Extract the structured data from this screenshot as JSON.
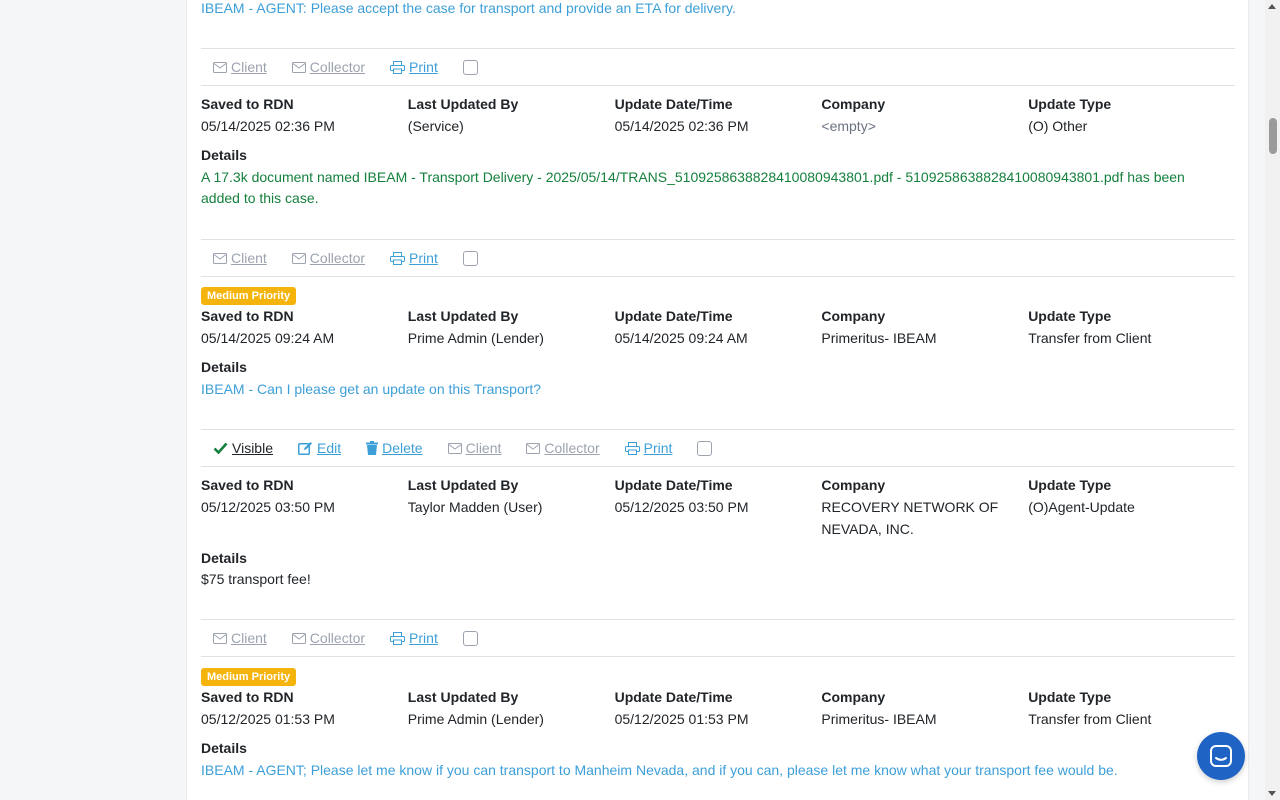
{
  "colors": {
    "link": "#3d9fd8",
    "badge": "#f5b40b",
    "system_text": "#15803d",
    "chat_button": "#1f64c4"
  },
  "labels": {
    "saved": "Saved to RDN",
    "by": "Last Updated By",
    "datetime": "Update Date/Time",
    "company": "Company",
    "type": "Update Type",
    "details": "Details"
  },
  "actions": {
    "visible": "Visible",
    "edit": "Edit",
    "delete": "Delete",
    "client": "Client",
    "collector": "Collector",
    "print": "Print"
  },
  "top_message": "IBEAM - AGENT: Please accept the case for transport and provide an ETA for delivery.",
  "updates": [
    {
      "saved": "05/14/2025 02:36 PM",
      "by": "(Service)",
      "datetime": "05/14/2025 02:36 PM",
      "company": "<empty>",
      "type": "(O) Other",
      "details": "A 17.3k document named IBEAM - Transport Delivery - 2025/05/14/TRANS_510925863882841008094380​1.pdf - 5109258638828410080943801.pdf has been added to this case."
    },
    {
      "badge": "Medium Priority",
      "saved": "05/14/2025 09:24 AM",
      "by": "Prime Admin (Lender)",
      "datetime": "05/14/2025 09:24 AM",
      "company": "Primeritus- IBEAM",
      "type": "Transfer from Client",
      "details": "IBEAM - Can I please get an update on this Transport?"
    },
    {
      "saved": "05/12/2025 03:50 PM",
      "by": "Taylor Madden (User)",
      "datetime": "05/12/2025 03:50 PM",
      "company": "RECOVERY NETWORK OF NEVADA, INC.",
      "type": "(O)Agent-Update",
      "details": "$75 transport fee!"
    },
    {
      "badge": "Medium Priority",
      "saved": "05/12/2025 01:53 PM",
      "by": "Prime Admin (Lender)",
      "datetime": "05/12/2025 01:53 PM",
      "company": "Primeritus- IBEAM",
      "type": "Transfer from Client",
      "details": "IBEAM - AGENT; Please let me know if you can transport to Manheim Nevada, and if you can, please let me know what your transport fee would be."
    }
  ],
  "icons": [
    "envelope-icon",
    "printer-icon",
    "check-icon",
    "edit-icon",
    "trash-icon",
    "chat-icon"
  ]
}
